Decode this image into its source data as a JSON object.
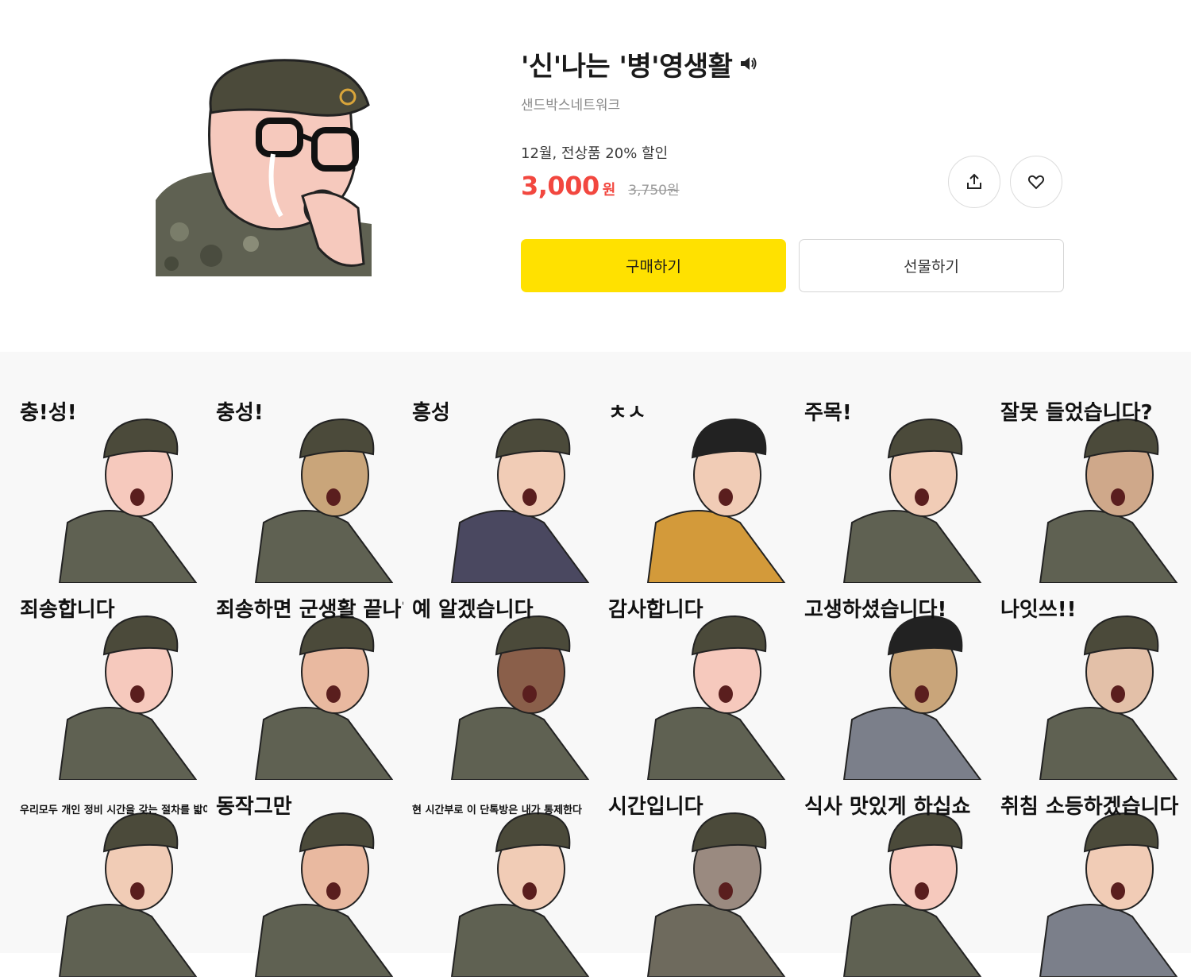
{
  "product": {
    "title": "'신'나는 '병'영생활",
    "author": "샌드박스네트워크",
    "promo": "12월, 전상품 20% 할인",
    "price": "3,000",
    "price_unit": "원",
    "original_price": "3,750원"
  },
  "actions": {
    "buy_label": "구매하기",
    "gift_label": "선물하기"
  },
  "icons": {
    "sound": "speaker-icon",
    "share": "share-icon",
    "like": "heart-icon"
  },
  "colors": {
    "accent_yellow": "#ffe100",
    "price_red": "#f2473f",
    "camo": "#5f6152",
    "beret": "#4b4a3a"
  },
  "stickers": [
    {
      "text": "충!성!"
    },
    {
      "text": "충성!"
    },
    {
      "text": "흥성"
    },
    {
      "text": "ㅊㅅ"
    },
    {
      "text": "주목!"
    },
    {
      "text": "잘못 들었습니다?"
    },
    {
      "text": "죄송합니다"
    },
    {
      "text": "죄송하면 군생활 끝나?"
    },
    {
      "text": "예 알겠습니다"
    },
    {
      "text": "감사합니다"
    },
    {
      "text": "고생하셨습니다!"
    },
    {
      "text": "나잇쓰!!"
    },
    {
      "text": "우리모두 개인 정비 시간을 갖는 절차를 밟아 보도록 하자!"
    },
    {
      "text": "동작그만"
    },
    {
      "text": "현 시간부로 이 단톡방은 내가 통제한다"
    },
    {
      "text": "시간입니다"
    },
    {
      "text": "식사 맛있게 하십쇼"
    },
    {
      "text": "취침 소등하겠습니다"
    }
  ]
}
